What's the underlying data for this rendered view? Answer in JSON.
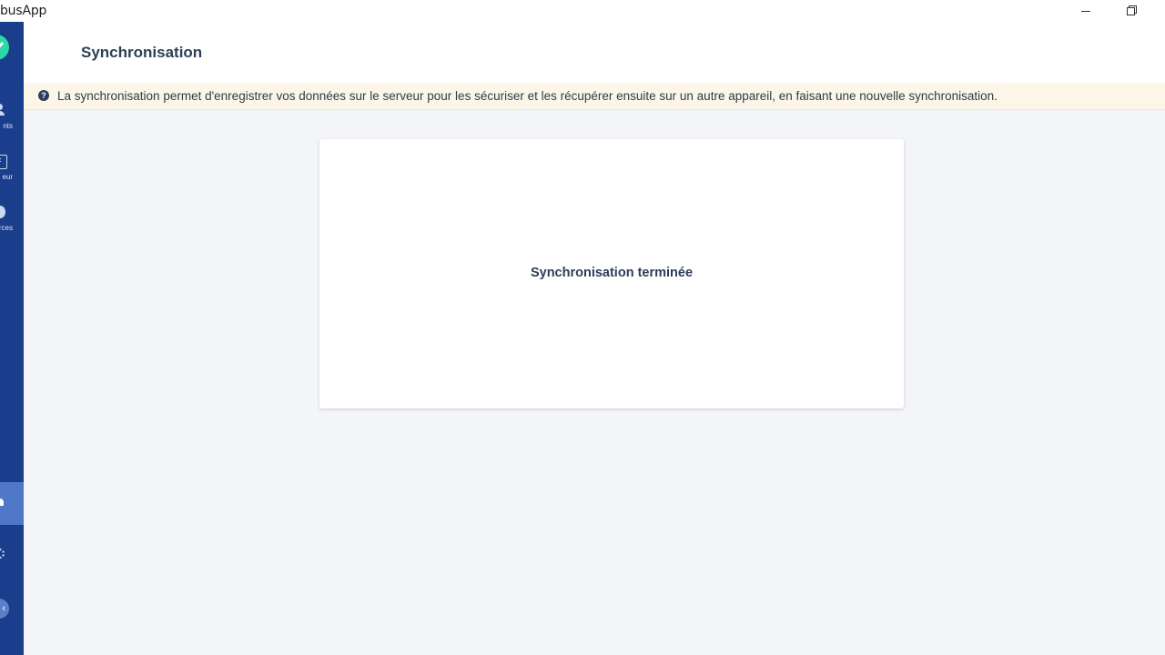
{
  "window": {
    "title": "busApp"
  },
  "sidebar": {
    "items": [
      {
        "label": "nts",
        "icon": "user-icon"
      },
      {
        "label": "eur",
        "icon": "document-icon"
      },
      {
        "label": "rces",
        "icon": "circle-icon"
      }
    ],
    "bottom_icons": [
      "home-icon",
      "gear-icon",
      "avatar"
    ]
  },
  "header": {
    "title": "Synchronisation"
  },
  "banner": {
    "icon": "question-circle-icon",
    "help_glyph": "?",
    "text": "La synchronisation permet d'enregistrer vos données sur le serveur pour les sécuriser et les récupérer ensuite sur un autre appareil, en faisant une nouvelle synchronisation."
  },
  "card": {
    "status": "Synchronisation terminée"
  },
  "colors": {
    "sidebar": "#1a3e8c",
    "sidebar_active": "#4f77c8",
    "logo": "#2bd9a6",
    "banner_bg": "#fbf6e8",
    "page_bg": "#f3f5f9",
    "text": "#2c3e57"
  }
}
